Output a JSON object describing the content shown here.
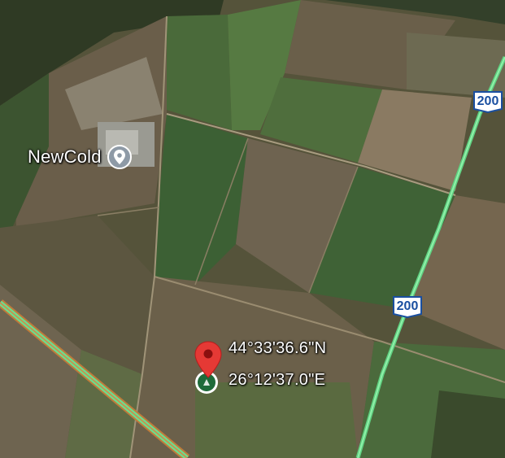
{
  "map": {
    "view": "satellite",
    "place": {
      "name": "NewCold",
      "icon": "location-pin-icon"
    },
    "roads": [
      {
        "route": "200",
        "icon": "road-shield-icon"
      },
      {
        "route": "200",
        "icon": "road-shield-icon"
      }
    ],
    "marker": {
      "icon": "red-map-pin-icon",
      "color": "#e53935",
      "latitude": "44°33'36.6\"N",
      "longitude": "26°12'37.0\"E"
    },
    "current_location": {
      "icon": "current-location-dot-icon",
      "color": "#1e6b3a"
    },
    "colors": {
      "highway": "#6fdc8c",
      "road_edge": "#c07a3a",
      "shield_border": "#1a4fa0"
    }
  }
}
